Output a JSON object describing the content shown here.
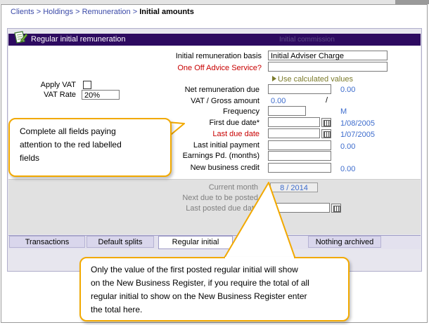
{
  "breadcrumb": {
    "items": [
      "Clients",
      "Holdings",
      "Remuneration"
    ],
    "separator": ">",
    "current": "Initial amounts"
  },
  "panel": {
    "title": "Regular initial remuneration",
    "ghost_heading": "Initial commission"
  },
  "fields": {
    "basis_label": "Initial remuneration basis",
    "basis_value": "Initial Adviser Charge",
    "one_off_label": "One Off Advice Service?",
    "one_off_value": "",
    "use_calc_label": "Use calculated values",
    "apply_vat_label": "Apply VAT",
    "vat_rate_label": "VAT Rate",
    "vat_rate_value": "20%",
    "net_due_label": "Net remuneration due",
    "net_due_calc": "0.00",
    "vat_gross_label": "VAT / Gross amount",
    "vat_gross_value": "0.00",
    "vat_gross_sep": "/",
    "frequency_label": "Frequency",
    "frequency_calc": "M",
    "first_due_label": "First due date*",
    "first_due_calc": "1/08/2005",
    "last_due_label": "Last due date",
    "last_due_calc": "1/07/2005",
    "last_payment_label": "Last initial payment",
    "last_payment_calc": "0.00",
    "earnings_label": "Earnings Pd. (months)",
    "new_business_label": "New business credit",
    "new_business_calc": "0.00"
  },
  "footer": {
    "current_month_label": "Current month",
    "current_month_value": "8 / 2014",
    "next_due_label": "Next due to be posted",
    "last_posted_label": "Last posted due date"
  },
  "tabs": [
    "Transactions",
    "Default splits",
    "Regular initial",
    "Nothing archived"
  ],
  "callouts": {
    "fields_note": [
      "Complete all fields paying",
      "attention to the red labelled",
      "fields"
    ],
    "register_note": [
      "Only the value of the first posted regular initial will show",
      "on the New Business Register, if you require the total of all",
      "regular initial to show on the New Business Register enter",
      "the total here."
    ]
  },
  "colors": {
    "title_bar": "#2d0a60",
    "callout_border": "#f2a900",
    "required_label": "#c80000",
    "calc_value": "#3d6ccd"
  },
  "icons": {
    "panel": "document-edit-icon",
    "calendar": "calendar-icon",
    "arrow": "play-arrow-icon"
  }
}
